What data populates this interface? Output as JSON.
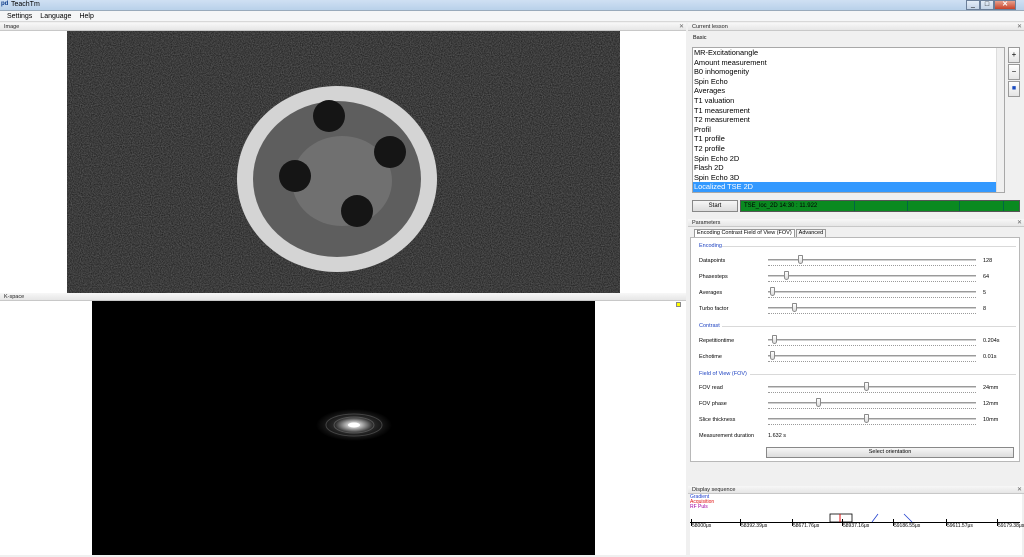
{
  "window": {
    "title": "TeachTm",
    "app_icon": "pd"
  },
  "window_buttons": {
    "minimize": "_",
    "maximize": "□",
    "close": "✕"
  },
  "menu": [
    "Settings",
    "Language",
    "Help"
  ],
  "panels": {
    "image": "Image",
    "kspace": "K-space",
    "current_lesson": "Current lesson",
    "parameters": "Parameters",
    "display_sequence": "Display sequence"
  },
  "lesson": {
    "category": "Basic",
    "items": [
      "MR-Excitationangle",
      "Amount measurement",
      "B0 inhomogenity",
      "Spin Echo",
      "Averages",
      "T1 valuation",
      "T1 measurement",
      "T2 measurement",
      "Profil",
      "T1 profile",
      "T2 profile",
      "Spin Echo 2D",
      "Flash 2D",
      "Spin Echo 3D",
      "Localized TSE 2D"
    ],
    "selected_index": 14,
    "side_buttons": [
      "+",
      "−",
      "💾"
    ]
  },
  "start": {
    "label": "Start",
    "status": "TSE_loc_2D 14:30 : 11.922",
    "progress": 1.0
  },
  "tabs": [
    "Encoding Contrast Field of View (FOV)",
    "Advanced"
  ],
  "groups": {
    "encoding": "Encoding",
    "contrast": "Contrast",
    "fov": "Field of View (FOV)"
  },
  "params": [
    {
      "label": "Datapoints",
      "value": "128",
      "level": 0.14
    },
    {
      "label": "Phasesteps",
      "value": "64",
      "level": 0.07
    },
    {
      "label": "Averages",
      "value": "5",
      "level": 0.0
    },
    {
      "label": "Turbo factor",
      "value": "8",
      "level": 0.11
    },
    {
      "label": "Repetitiontime",
      "value": "0.204s",
      "level": 0.01
    },
    {
      "label": "Echotime",
      "value": "0.01s",
      "level": 0.0
    },
    {
      "label": "FOV read",
      "value": "24mm",
      "level": 0.47
    },
    {
      "label": "FOV phase",
      "value": "12mm",
      "level": 0.23
    },
    {
      "label": "Slice thickness",
      "value": "10mm",
      "level": 0.47
    }
  ],
  "measurement": {
    "label": "Measurement duration",
    "value": "1.632 s"
  },
  "orientation_button": "Select orientation",
  "sequence": {
    "legend": [
      "Gradient",
      "Acquisition",
      "RF Puls"
    ],
    "legend_colors": [
      "#1f3fd0",
      "#e01010",
      "#a000a0"
    ],
    "axis_labels": [
      "58000μs",
      "58392.39μs",
      "58671.76μs",
      "58937.16μs",
      "59186.55μs",
      "59611.57μs",
      "59179.38μs"
    ]
  }
}
